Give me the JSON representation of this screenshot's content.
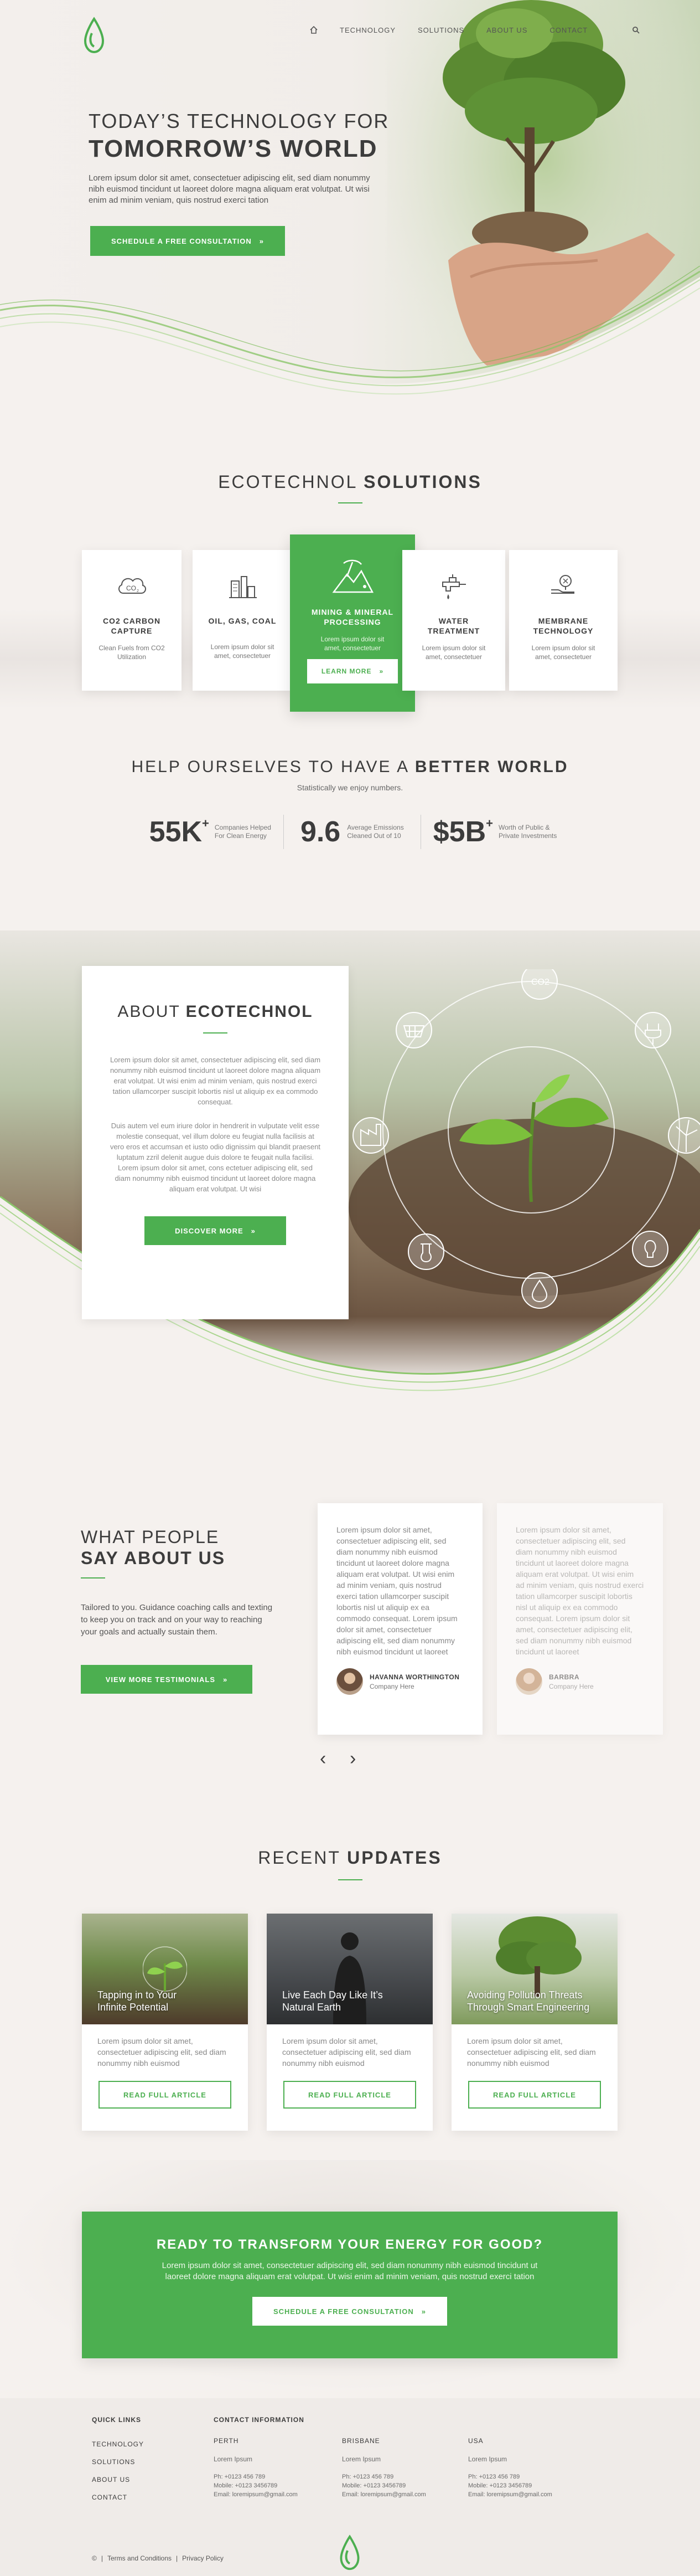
{
  "colors": {
    "accent": "#4caf50",
    "background": "#f5f1ee",
    "text": "#3c3c3c"
  },
  "nav": {
    "home_icon": "home-icon",
    "items": [
      "TECHNOLOGY",
      "SOLUTIONS",
      "ABOUT US",
      "CONTACT"
    ],
    "search_icon": "search-icon"
  },
  "hero": {
    "line1": "TODAY’S TECHNOLOGY FOR",
    "line2": "TOMORROW’S WORLD",
    "body": "Lorem ipsum dolor sit amet, consectetuer adipiscing elit, sed diam nonummy nibh euismod tincidunt ut laoreet dolore magna aliquam erat volutpat. Ut wisi enim ad minim veniam, quis nostrud exerci tation",
    "cta": "SCHEDULE A FREE CONSULTATION",
    "cta_arrow": "»"
  },
  "solutions": {
    "title_light": "ECOTECHNOL",
    "title_bold": "SOLUTIONS",
    "cards": [
      {
        "icon": "co2-icon",
        "title1": "CO2 CARBON",
        "title2": "CAPTURE",
        "desc1": "Clean Fuels from CO2",
        "desc2": "Utilization"
      },
      {
        "icon": "oil-gas-coal-icon",
        "title1": "OIL, GAS, COAL",
        "title2": "",
        "desc1": "Lorem ipsum dolor sit",
        "desc2": "amet, consectetuer"
      },
      {
        "icon": "mining-icon",
        "title1": "MINING & MINERAL",
        "title2": "PROCESSING",
        "desc1": "Lorem ipsum dolor sit",
        "desc2": "amet, consectetuer",
        "button": "LEARN MORE",
        "arrow": "»"
      },
      {
        "icon": "water-tap-icon",
        "title1": "WATER",
        "title2": "TREATMENT",
        "desc1": "Lorem ipsum dolor sit",
        "desc2": "amet, consectetuer"
      },
      {
        "icon": "membrane-icon",
        "title1": "MEMBRANE",
        "title2": "TECHNOLOGY",
        "desc1": "Lorem ipsum dolor sit",
        "desc2": "amet, consectetuer"
      }
    ]
  },
  "better": {
    "title_light": "HELP OURSELVES TO HAVE A",
    "title_bold": "BETTER WORLD",
    "subtitle": "Statistically we enjoy numbers.",
    "stats": [
      {
        "value": "55K",
        "sup": "+",
        "line1": "Companies Helped",
        "line2": "For Clean Energy"
      },
      {
        "value": "9.6",
        "sup": "",
        "line1": "Average Emissions",
        "line2": "Cleaned Out of 10"
      },
      {
        "value": "$5B",
        "sup": "+",
        "line1": "Worth of Public &",
        "line2": "Private Investments"
      }
    ]
  },
  "about": {
    "title_light": "ABOUT",
    "title_bold": "ECOTECHNOL",
    "p1": "Lorem ipsum dolor sit amet, consectetuer adipiscing elit, sed diam nonummy nibh euismod tincidunt ut laoreet dolore magna aliquam erat volutpat. Ut wisi enim ad minim veniam, quis nostrud exerci tation ullamcorper suscipit lobortis nisl ut aliquip ex ea commodo consequat.",
    "p2": "Duis autem vel eum iriure dolor in hendrerit in vulputate velit esse molestie consequat, vel illum dolore eu feugiat nulla facilisis at vero eros et accumsan et iusto odio dignissim qui blandit praesent luptatum zzril delenit augue duis dolore te feugait nulla facilisi.",
    "p3": "Lorem ipsum dolor sit amet, cons ectetuer adipiscing elit, sed diam nonummy nibh euismod tincidunt ut laoreet dolore magna aliquam erat volutpat. Ut wisi",
    "button": "DISCOVER MORE",
    "arrow": "»",
    "circle_icons": [
      "co2-icon",
      "solar-panel-icon",
      "plug-icon",
      "factory-icon",
      "wind-turbine-icon",
      "flask-icon",
      "lightbulb-icon",
      "drop-icon"
    ],
    "co2_label": "CO2"
  },
  "testimonials": {
    "title_line1": "WHAT PEOPLE",
    "title_line2": "SAY ABOUT US",
    "body": "Tailored to you. Guidance coaching calls and texting to keep you on track and on your way to reaching your goals and actually sustain them.",
    "button": "VIEW MORE TESTIMONIALS",
    "arrow": "»",
    "cards": [
      {
        "text": "Lorem ipsum dolor sit amet, consectetuer adipiscing elit, sed diam nonummy nibh euismod tincidunt ut laoreet dolore magna aliquam erat volutpat. Ut wisi enim ad minim veniam, quis nostrud exerci tation ullamcorper suscipit lobortis nisl ut aliquip ex ea commodo consequat. Lorem ipsum dolor sit amet, consectetuer adipiscing elit, sed diam nonummy nibh euismod tincidunt ut laoreet",
        "name": "HAVANNA WORTHINGTON",
        "company": "Company Here"
      },
      {
        "text": "Lorem ipsum dolor sit amet, consectetuer adipiscing elit, sed diam nonummy nibh euismod tincidunt ut laoreet dolore magna aliquam erat volutpat. Ut wisi enim ad minim veniam, quis nostrud exerci tation ullamcorper suscipit lobortis nisl ut aliquip ex ea commodo consequat. Lorem ipsum dolor sit amet, consectetuer adipiscing elit, sed diam nonummy nibh euismod tincidunt ut laoreet",
        "name": "BARBRA",
        "company": "Company Here"
      }
    ],
    "prev": "‹",
    "next": "›"
  },
  "updates": {
    "title_light": "RECENT",
    "title_bold": "UPDATES",
    "posts": [
      {
        "title1": "Tapping in to Your",
        "title2": "Infinite Potential",
        "body": "Lorem ipsum dolor sit amet, consectetuer adipiscing elit, sed diam nonummy nibh euismod",
        "button": "READ FULL ARTICLE"
      },
      {
        "title1": "Live Each Day Like It’s",
        "title2": "Natural Earth",
        "body": "Lorem ipsum dolor sit amet, consectetuer adipiscing elit, sed diam nonummy nibh euismod",
        "button": "READ FULL ARTICLE"
      },
      {
        "title1": "Avoiding Pollution Threats",
        "title2": "Through Smart Engineering",
        "body": "Lorem ipsum dolor sit amet, consectetuer adipiscing elit, sed diam nonummy nibh euismod",
        "button": "READ FULL ARTICLE"
      }
    ]
  },
  "cta": {
    "title": "READY TO TRANSFORM YOUR ENERGY FOR GOOD?",
    "body": "Lorem ipsum dolor sit amet, consectetuer adipiscing elit, sed diam nonummy nibh euismod tincidunt ut laoreet dolore magna aliquam erat volutpat. Ut wisi enim ad minim veniam, quis nostrud exerci tation",
    "button": "SCHEDULE A FREE CONSULTATION",
    "arrow": "»"
  },
  "footer": {
    "quick_links_title": "QUICK LINKS",
    "quick_links": [
      "TECHNOLOGY",
      "SOLUTIONS",
      "ABOUT US",
      "CONTACT"
    ],
    "contact_title": "CONTACT INFORMATION",
    "offices": [
      {
        "city": "PERTH",
        "address": "Lorem Ipsum",
        "phone": "Ph: +0123 456 789",
        "mobile": "Mobile: +0123 3456789",
        "email": "Email: loremipsum@gmail.com"
      },
      {
        "city": "BRISBANE",
        "address": "Lorem Ipsum",
        "phone": "Ph: +0123 456 789",
        "mobile": "Mobile: +0123 3456789",
        "email": "Email: loremipsum@gmail.com"
      },
      {
        "city": "USA",
        "address": "Lorem Ipsum",
        "phone": "Ph: +0123 456 789",
        "mobile": "Mobile: +0123 3456789",
        "email": "Email: loremipsum@gmail.com"
      }
    ],
    "copyright": "©",
    "terms": "Terms and Conditions",
    "sep": "|",
    "privacy": "Privacy Policy"
  }
}
